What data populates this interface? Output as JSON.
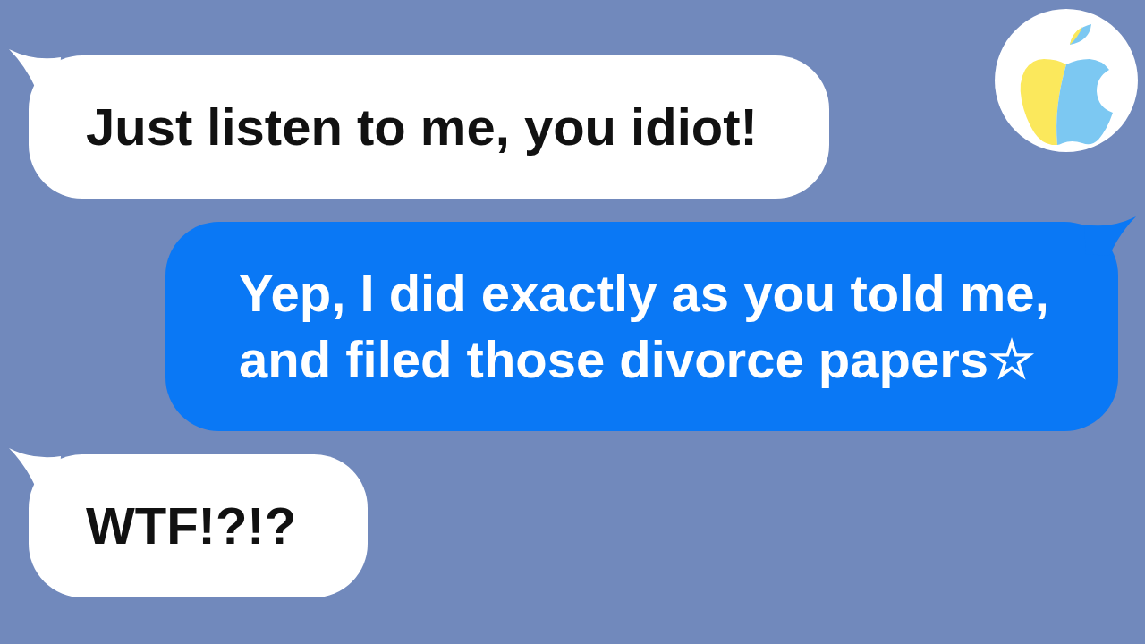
{
  "avatar": {
    "kind": "apple"
  },
  "messages": [
    {
      "kind": "received",
      "text": "Just listen to me, you idiot!"
    },
    {
      "kind": "sent",
      "text": "Yep, I did exactly as you told me, and filed those divorce papers☆"
    },
    {
      "kind": "received",
      "text": "WTF!?!?"
    }
  ]
}
